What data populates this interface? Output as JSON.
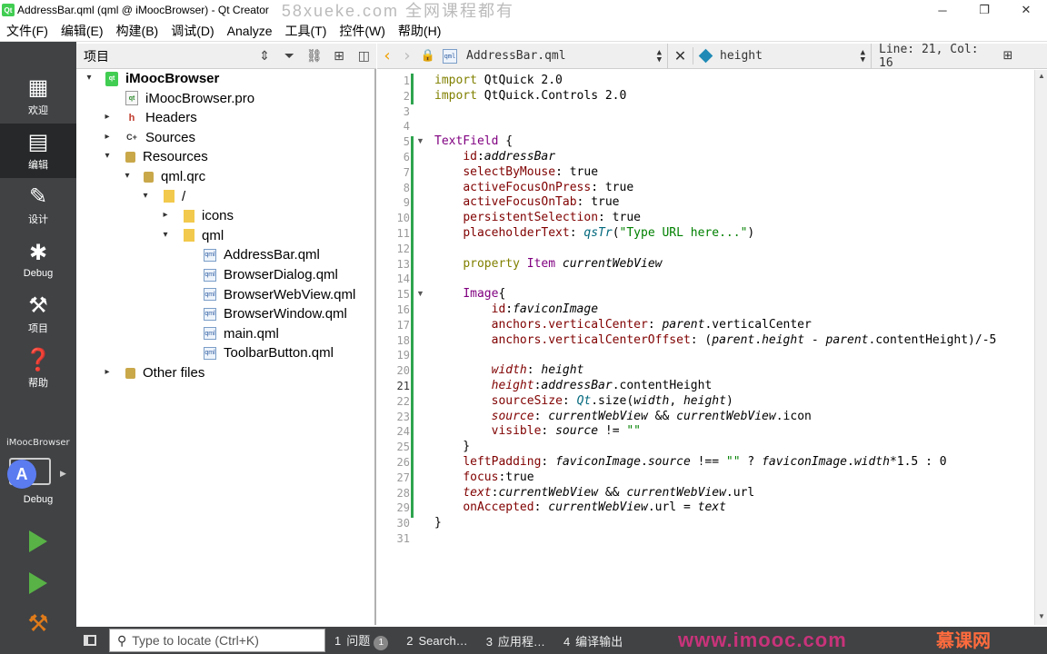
{
  "window": {
    "title": "AddressBar.qml (qml @ iMoocBrowser) - Qt Creator",
    "watermark": "58xueke.com 全网课程都有"
  },
  "menubar": [
    "文件(F)",
    "编辑(E)",
    "构建(B)",
    "调试(D)",
    "Analyze",
    "工具(T)",
    "控件(W)",
    "帮助(H)"
  ],
  "modes": [
    {
      "label": "欢迎",
      "icon": "welcome-grid-icon"
    },
    {
      "label": "编辑",
      "icon": "edit-document-icon"
    },
    {
      "label": "设计",
      "icon": "pencil-icon"
    },
    {
      "label": "Debug",
      "icon": "bug-icon"
    },
    {
      "label": "项目",
      "icon": "wrench-icon"
    },
    {
      "label": "帮助",
      "icon": "help-icon"
    }
  ],
  "kit": {
    "project": "iMoocBrowser",
    "config": "Debug"
  },
  "project_pane": {
    "title": "项目"
  },
  "tree": [
    {
      "label": "iMoocBrowser",
      "icon": "root",
      "level": 0,
      "arrow": "▾"
    },
    {
      "label": "iMoocBrowser.pro",
      "icon": "pro",
      "level": 1,
      "arrow": ""
    },
    {
      "label": "Headers",
      "icon": "h",
      "level": 1,
      "arrow": "▸"
    },
    {
      "label": "Sources",
      "icon": "c",
      "level": 1,
      "arrow": "▸"
    },
    {
      "label": "Resources",
      "icon": "lock",
      "level": 1,
      "arrow": "▾"
    },
    {
      "label": "qml.qrc",
      "icon": "lock",
      "level": 2,
      "arrow": "▾"
    },
    {
      "label": "/",
      "icon": "folder",
      "level": 3,
      "arrow": "▾"
    },
    {
      "label": "icons",
      "icon": "folder",
      "level": 4,
      "arrow": "▸"
    },
    {
      "label": "qml",
      "icon": "folder",
      "level": 4,
      "arrow": "▾"
    },
    {
      "label": "AddressBar.qml",
      "icon": "qml",
      "level": 5,
      "arrow": ""
    },
    {
      "label": "BrowserDialog.qml",
      "icon": "qml",
      "level": 5,
      "arrow": ""
    },
    {
      "label": "BrowserWebView.qml",
      "icon": "qml",
      "level": 5,
      "arrow": ""
    },
    {
      "label": "BrowserWindow.qml",
      "icon": "qml",
      "level": 5,
      "arrow": ""
    },
    {
      "label": "main.qml",
      "icon": "qml",
      "level": 5,
      "arrow": ""
    },
    {
      "label": "ToolbarButton.qml",
      "icon": "qml",
      "level": 5,
      "arrow": ""
    },
    {
      "label": "Other files",
      "icon": "lock",
      "level": 1,
      "arrow": "▸"
    }
  ],
  "editor_toolbar": {
    "file": "AddressBar.qml",
    "symbol": "height",
    "position": "Line: 21, Col: 16"
  },
  "editor": {
    "current_line": 21,
    "lines": [
      "import QtQuick 2.0",
      "import QtQuick.Controls 2.0",
      "",
      "",
      "TextField {",
      "    id:addressBar",
      "    selectByMouse: true",
      "    activeFocusOnPress: true",
      "    activeFocusOnTab: true",
      "    persistentSelection: true",
      "    placeholderText: qsTr(\"Type URL here...\")",
      "",
      "    property Item currentWebView",
      "",
      "    Image{",
      "        id:faviconImage",
      "        anchors.verticalCenter: parent.verticalCenter",
      "        anchors.verticalCenterOffset: (parent.height - parent.contentHeight)/-5",
      "",
      "        width: height",
      "        height:addressBar.contentHeight",
      "        sourceSize: Qt.size(width, height)",
      "        source: currentWebView && currentWebView.icon",
      "        visible: source != \"\"",
      "    }",
      "    leftPadding: faviconImage.source !== \"\" ? faviconImage.width*1.5 : 0",
      "    focus:true",
      "    text:currentWebView && currentWebView.url",
      "    onAccepted: currentWebView.url = text",
      "}",
      ""
    ]
  },
  "statusbar": {
    "locator_placeholder": "Type to locate (Ctrl+K)",
    "tabs": [
      {
        "num": "1",
        "label": "问题",
        "badge": "1"
      },
      {
        "num": "2",
        "label": "Search…",
        "badge": ""
      },
      {
        "num": "3",
        "label": "应用程…",
        "badge": ""
      },
      {
        "num": "4",
        "label": "编译输出",
        "badge": ""
      }
    ],
    "brand": "www.imooc.com",
    "brand2": "慕课网"
  }
}
